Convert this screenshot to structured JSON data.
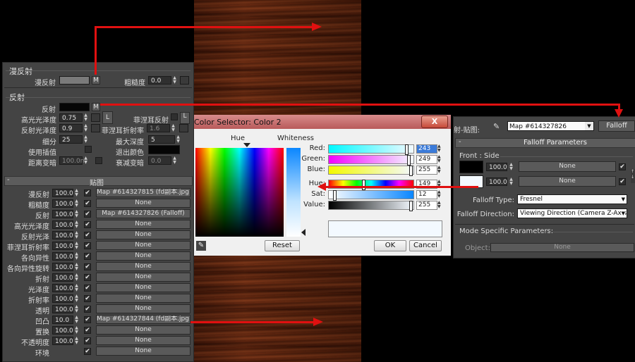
{
  "left_panel": {
    "diffuse_group": {
      "title": "漫反射",
      "diffuse_label": "漫反射",
      "m_label": "M",
      "roughness_label": "粗糙度",
      "roughness_value": "0.0"
    },
    "reflection_group": {
      "title": "反射",
      "reflect_label": "反射",
      "m_label": "M",
      "hilight_gloss_label": "高光光泽度",
      "hilight_gloss_value": "0.75",
      "lock_label": "L",
      "fresnel_label": "菲涅耳反射",
      "refl_gloss_label": "反射光泽度",
      "refl_gloss_value": "0.9",
      "fresnel_ior_label": "菲涅耳折射率",
      "fresnel_ior_value": "1.6",
      "subdivs_label": "细分",
      "subdivs_value": "25",
      "max_depth_label": "最大深度",
      "max_depth_value": "5",
      "use_interp_label": "使用插值",
      "exit_color_label": "退出颜色",
      "dim_dist_label": "距离变暗",
      "dim_dist_value": "100.0n",
      "dim_falloff_label": "衰减变暗",
      "dim_falloff_value": "0.0"
    },
    "maps": {
      "title": "贴图",
      "rows": [
        {
          "label": "漫反射",
          "value": "100.0",
          "map": "Map #614327815 (fd副本.jpg)"
        },
        {
          "label": "粗糙度",
          "value": "100.0",
          "map": "None"
        },
        {
          "label": "反射",
          "value": "100.0",
          "map": "Map #614327826  (Falloff)"
        },
        {
          "label": "高光光泽度",
          "value": "100.0",
          "map": "None"
        },
        {
          "label": "反射光泽",
          "value": "100.0",
          "map": "None"
        },
        {
          "label": "菲涅耳折射率",
          "value": "100.0",
          "map": "None"
        },
        {
          "label": "各向异性",
          "value": "100.0",
          "map": "None"
        },
        {
          "label": "各向异性旋转",
          "value": "100.0",
          "map": "None"
        },
        {
          "label": "折射",
          "value": "100.0",
          "map": "None"
        },
        {
          "label": "光泽度",
          "value": "100.0",
          "map": "None"
        },
        {
          "label": "折射率",
          "value": "100.0",
          "map": "None"
        },
        {
          "label": "透明",
          "value": "100.0",
          "map": "None"
        },
        {
          "label": "凹凸",
          "value": "10.0",
          "map": "Map #614327844 (fd副本.jpg)"
        },
        {
          "label": "置换",
          "value": "100.0",
          "map": "None"
        },
        {
          "label": "不透明度",
          "value": "100.0",
          "map": "None"
        },
        {
          "label": "环境",
          "value": "",
          "map": "None"
        }
      ]
    }
  },
  "color_selector": {
    "title": "Color Selector: Color 2",
    "hue_label": "Hue",
    "whiteness_label": "Whiteness",
    "channels": [
      {
        "label": "Red:",
        "value": "243"
      },
      {
        "label": "Green:",
        "value": "249"
      },
      {
        "label": "Blue:",
        "value": "255"
      },
      {
        "label": "Hue:",
        "value": "149"
      },
      {
        "label": "Sat:",
        "value": "12"
      },
      {
        "label": "Value:",
        "value": "255"
      }
    ],
    "reset_label": "Reset",
    "ok_label": "OK",
    "cancel_label": "Cancel",
    "close_label": "X",
    "preview_color": "#f3f9ff"
  },
  "falloff_panel": {
    "map_label": "射-贴图:",
    "map_name": "Map #614327826",
    "type_button": "Falloff",
    "params_title": "Falloff Parameters",
    "front_side_label": "Front : Side",
    "rows": [
      {
        "value": "100.0",
        "map": "None",
        "color": "#000000"
      },
      {
        "value": "100.0",
        "map": "None",
        "color": "#f3f9ff"
      }
    ],
    "falloff_type_label": "Falloff Type:",
    "falloff_type_value": "Fresnel",
    "falloff_direction_label": "Falloff Direction:",
    "falloff_direction_value": "Viewing Direction (Camera Z-Axis)",
    "mode_title": "Mode Specific Parameters:",
    "object_label": "Object:",
    "object_value": "None"
  },
  "colors": {
    "arrow": "#e01010",
    "panel_bg": "#444444",
    "dialog_title_bg": "#b85a5a"
  }
}
